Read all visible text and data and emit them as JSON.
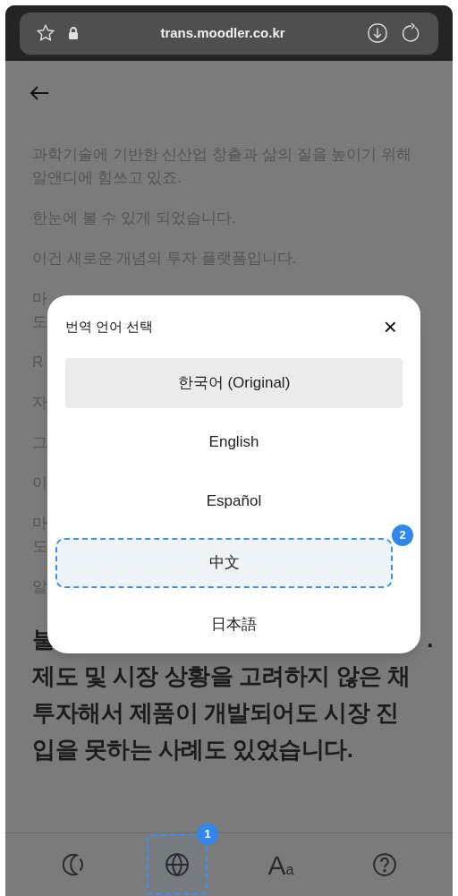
{
  "browser": {
    "url": "trans.moodler.co.kr"
  },
  "paragraphs": [
    {
      "bold": false,
      "lines": [
        "과학기술에 기반한 신산업 창출과 삶의 질을 높이기 위해",
        "알앤디에 힘쓰고 있죠."
      ]
    },
    {
      "bold": false,
      "lines": [
        "한눈에 볼 수 있게 되었습니다."
      ]
    },
    {
      "bold": false,
      "lines": [
        "이건 새로운 개념의 투자 플랫폼입니다."
      ]
    },
    {
      "bold": false,
      "lines": [
        "마",
        "도"
      ]
    },
    {
      "bold": false,
      "lines": [
        "R"
      ]
    },
    {
      "bold": false,
      "lines": [
        "자"
      ]
    },
    {
      "bold": false,
      "lines": [
        "그"
      ]
    },
    {
      "bold": false,
      "lines": [
        "이"
      ]
    },
    {
      "bold": false,
      "lines": [
        "마",
        "도"
      ]
    },
    {
      "bold": false,
      "lines": [
        "알"
      ]
    },
    {
      "bold": true,
      "lead": "불",
      "tail": ".",
      "lines": [
        "제도 및 시장 상황을 고려하지 않은 채",
        "투자해서 제품이 개발되어도 시장 진",
        "입을 못하는 사례도 있었습니다."
      ]
    }
  ],
  "dialog": {
    "title": "번역 언어 선택",
    "close": "×",
    "options": [
      {
        "label": "한국어 (Original)",
        "selected": true,
        "highlight": false
      },
      {
        "label": "English",
        "selected": false,
        "highlight": false
      },
      {
        "label": "Español",
        "selected": false,
        "highlight": false
      },
      {
        "label": "中文",
        "selected": false,
        "highlight": true,
        "badge": "2"
      },
      {
        "label": "日本語",
        "selected": false,
        "highlight": false
      }
    ]
  },
  "toolbar": [
    {
      "kind": "moon",
      "highlight": false
    },
    {
      "kind": "globe",
      "highlight": true,
      "badge": "1"
    },
    {
      "kind": "text",
      "label": "A$_{a}$",
      "highlight": false
    },
    {
      "kind": "help",
      "highlight": false
    }
  ]
}
